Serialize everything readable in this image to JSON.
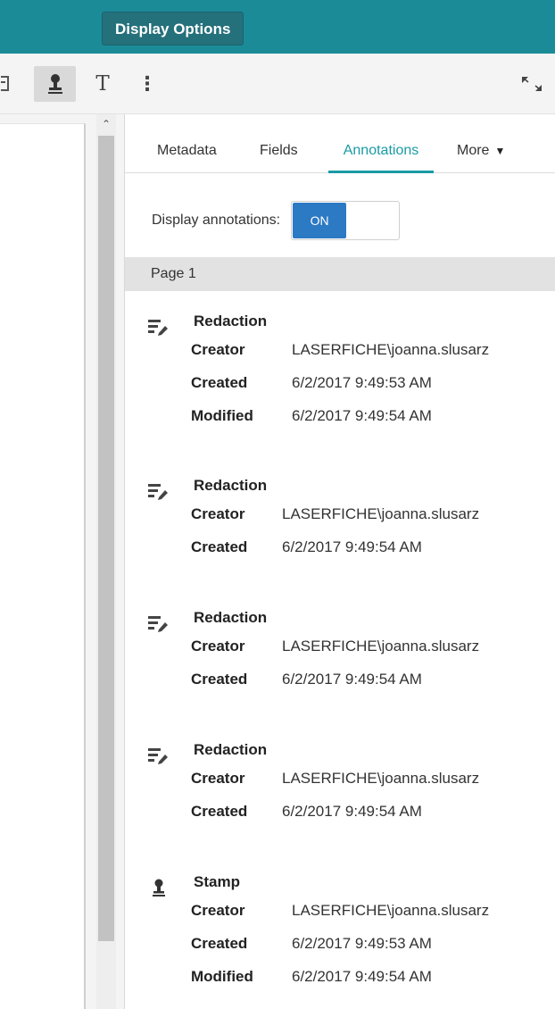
{
  "header": {
    "display_options_label": "Display Options"
  },
  "toolbar": {
    "partial_icon": "document-icon",
    "stamp_icon": "stamp-icon",
    "text_icon": "text-icon",
    "text_glyph": "T",
    "more_glyph": "⋮",
    "expand_glyph": "⤡"
  },
  "tabs": {
    "metadata": "Metadata",
    "fields": "Fields",
    "annotations": "Annotations",
    "more": "More"
  },
  "display_annotations": {
    "label": "Display annotations:",
    "toggle_value": "ON"
  },
  "page_header": "Page 1",
  "colors": {
    "topbar": "#1b8b98",
    "accent": "#1a9aa5",
    "toggle_on": "#2c79c4"
  },
  "annotations": [
    {
      "type": "Redaction",
      "icon": "redaction-icon",
      "creator_label": "Creator",
      "creator": "LASERFICHE\\joanna.slusarz",
      "created_label": "Created",
      "created": "6/2/2017 9:49:53 AM",
      "modified_label": "Modified",
      "modified": "6/2/2017 9:49:54 AM"
    },
    {
      "type": "Redaction",
      "icon": "redaction-icon",
      "creator_label": "Creator",
      "creator": "LASERFICHE\\joanna.slusarz",
      "created_label": "Created",
      "created": "6/2/2017 9:49:54 AM"
    },
    {
      "type": "Redaction",
      "icon": "redaction-icon",
      "creator_label": "Creator",
      "creator": "LASERFICHE\\joanna.slusarz",
      "created_label": "Created",
      "created": "6/2/2017 9:49:54 AM"
    },
    {
      "type": "Redaction",
      "icon": "redaction-icon",
      "creator_label": "Creator",
      "creator": "LASERFICHE\\joanna.slusarz",
      "created_label": "Created",
      "created": "6/2/2017 9:49:54 AM"
    },
    {
      "type": "Stamp",
      "icon": "stamp-icon",
      "creator_label": "Creator",
      "creator": "LASERFICHE\\joanna.slusarz",
      "created_label": "Created",
      "created": "6/2/2017 9:49:53 AM",
      "modified_label": "Modified",
      "modified": "6/2/2017 9:49:54 AM"
    }
  ]
}
